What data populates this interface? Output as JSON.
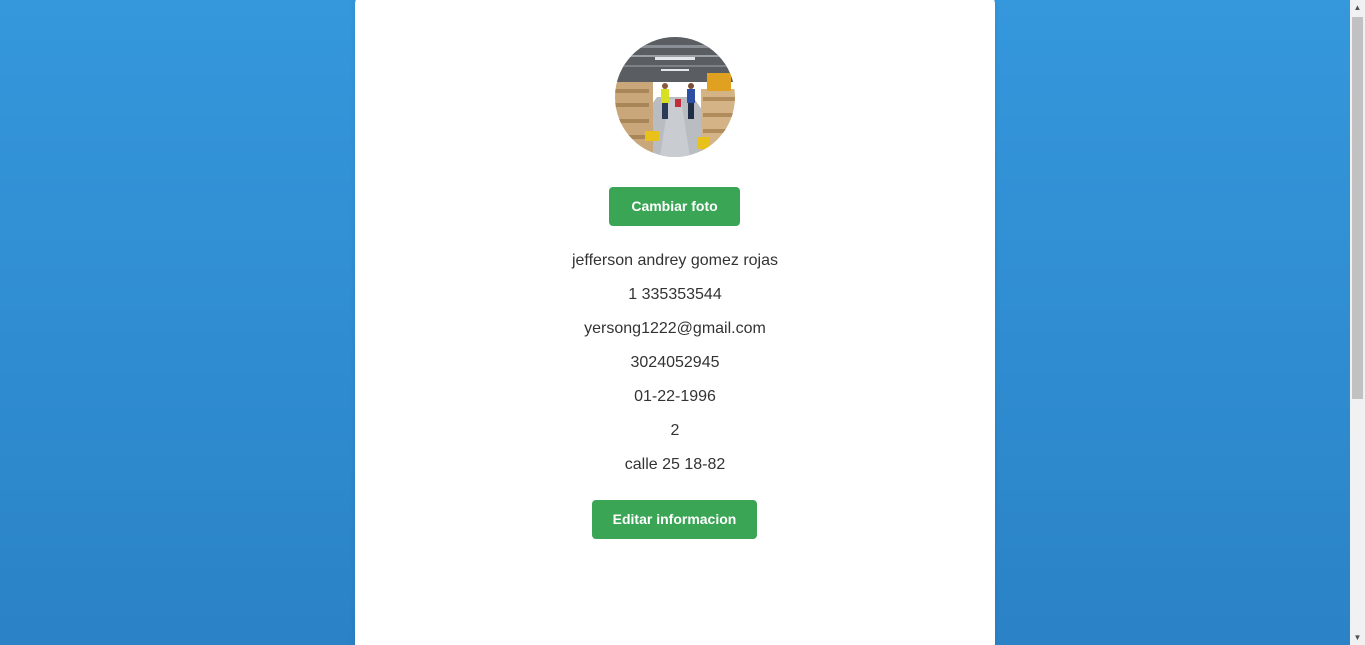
{
  "profile": {
    "change_photo_label": "Cambiar foto",
    "name": "jefferson andrey gomez rojas",
    "document": "1 335353544",
    "email": "yersong1222@gmail.com",
    "phone": "3024052945",
    "birth_date": "01-22-1996",
    "number": "2",
    "address": "calle 25 18-82",
    "edit_label": "Editar informacion"
  },
  "colors": {
    "background": "#3597dc",
    "button": "#3aa655",
    "card": "#ffffff",
    "text": "#333333"
  },
  "icons": {
    "scroll_up": "up-arrow-icon",
    "scroll_down": "down-arrow-icon"
  }
}
